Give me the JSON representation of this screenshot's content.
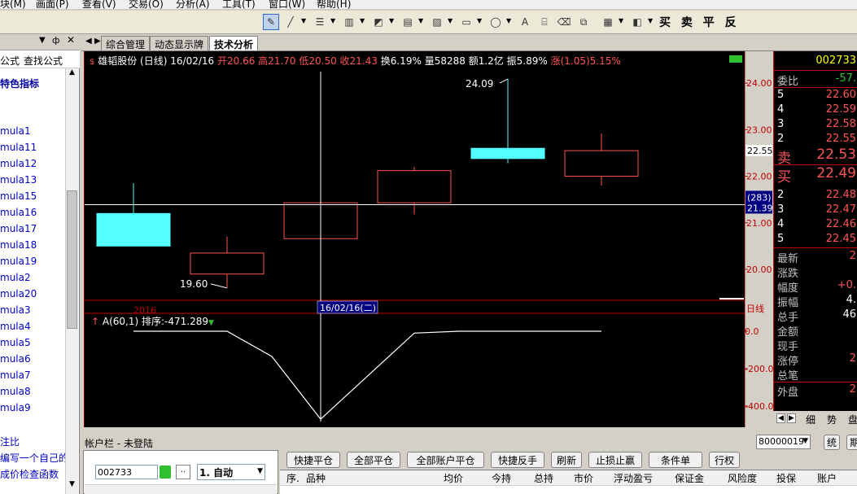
{
  "menu": [
    "块(M)",
    "画面(P)",
    "查看(V)",
    "交易(O)",
    "分析(A)",
    "工具(T)",
    "窗口(W)",
    "帮助(H)"
  ],
  "toolbar": {
    "trade_buttons": "买 卖 平 反"
  },
  "left_panel": {
    "tabs": [
      "公式",
      "查找公式"
    ],
    "heading": "特色指标",
    "formulas": [
      "mula1",
      "mula11",
      "mula12",
      "mula13",
      "mula15",
      "mula16",
      "mula17",
      "mula18",
      "mula19",
      "mula2",
      "mula20",
      "mula3",
      "mula4",
      "mula5",
      "mula6",
      "mula7",
      "mula8",
      "mula9"
    ],
    "footer": [
      "注比",
      "编写一个自己的:",
      "成价检查函数"
    ]
  },
  "tabs": [
    "综合管理",
    "动态显示牌",
    "技术分析"
  ],
  "stock": {
    "name": "雄韬股份",
    "period": "(日线)",
    "date": "16/02/16",
    "open": "开20.66",
    "high": "高21.70",
    "low": "低20.50",
    "close": "收21.43",
    "turnover": "换6.19%",
    "volume": "量58288",
    "amount": "额1.2亿",
    "amplitude": "振5.89%",
    "change": "涨(1.05)5.15%",
    "code": "002733"
  },
  "chart_data": {
    "type": "candlestick",
    "candles": [
      {
        "open": 21.2,
        "high": 21.85,
        "low": 20.78,
        "close": 20.5,
        "color": "#54ffff"
      },
      {
        "open": 19.9,
        "high": 20.7,
        "low": 19.6,
        "close": 20.35,
        "color": "#ff5454"
      },
      {
        "open": 20.66,
        "high": 21.7,
        "low": 20.5,
        "close": 21.43,
        "color": "#ff5454"
      },
      {
        "open": 21.43,
        "high": 22.2,
        "low": 21.18,
        "close": 22.12,
        "color": "#ff5454"
      },
      {
        "open": 22.6,
        "high": 24.09,
        "low": 22.28,
        "close": 22.38,
        "color": "#54ffff"
      },
      {
        "open": 22.0,
        "high": 22.92,
        "low": 21.8,
        "close": 22.55,
        "color": "#ff5454"
      }
    ],
    "ylim": [
      19.3,
      24.3
    ],
    "y_ticks": [
      "24.00",
      "23.00",
      "22.00",
      "21.00",
      "20.00"
    ],
    "annot_high": "24.09",
    "annot_low": "19.60",
    "crosshair_price": "21.39",
    "crosshair_count": "(283)",
    "last_price": "22.55",
    "year_label": "2016",
    "cursor_date": "16/02/16(二)",
    "period_label": "日线",
    "indicator": {
      "name": "A(60,1)",
      "rank": "排序:-471.289",
      "values": [
        0,
        0,
        -135,
        -470,
        -10,
        0,
        0
      ],
      "ylim": [
        -470,
        0
      ],
      "y_ticks": [
        "0.0",
        "-200.0",
        "-400.0"
      ]
    }
  },
  "quote": {
    "code": "002733",
    "ratio_label": "委比",
    "ratio": "-57.",
    "asks": [
      {
        "n": "5",
        "p": "22.60"
      },
      {
        "n": "4",
        "p": "22.59"
      },
      {
        "n": "3",
        "p": "22.58"
      },
      {
        "n": "2",
        "p": "22.55"
      },
      {
        "n": "卖",
        "p": "22.53"
      }
    ],
    "bids": [
      {
        "n": "买",
        "p": "22.49"
      },
      {
        "n": "2",
        "p": "22.48"
      },
      {
        "n": "3",
        "p": "22.47"
      },
      {
        "n": "4",
        "p": "22.46"
      },
      {
        "n": "5",
        "p": "22.45"
      }
    ],
    "stats": [
      {
        "l": "最新",
        "v": "2"
      },
      {
        "l": "涨跌",
        "v": ""
      },
      {
        "l": "幅度",
        "v": "+0."
      },
      {
        "l": "振幅",
        "v": "4."
      },
      {
        "l": "总手",
        "v": "46"
      },
      {
        "l": "金额",
        "v": ""
      },
      {
        "l": "现手",
        "v": ""
      },
      {
        "l": "涨停",
        "v": "2"
      },
      {
        "l": "总笔",
        "v": ""
      },
      {
        "l": "外盘",
        "v": "2"
      }
    ],
    "tabs": [
      "细",
      "势",
      "盘"
    ]
  },
  "bottom": {
    "title": "帐户栏",
    "status": "- 未登陆",
    "account": "80000019",
    "code_input": "002733",
    "mode": "1. 自动",
    "right_btns": [
      "统",
      "期"
    ],
    "buttons": [
      "快捷平仓",
      "全部平仓",
      "全部账户平仓",
      "快捷反手",
      "刷新",
      "止损止赢",
      "条件单",
      "行权"
    ],
    "columns": [
      "序.",
      "品种",
      "均价",
      "今持",
      "总持",
      "市价",
      "浮动盈亏",
      "保证金",
      "风险度",
      "投保",
      "账户"
    ]
  },
  "colors": {
    "up": "#ff5454",
    "down": "#54ffff",
    "axis": "#c00000"
  }
}
